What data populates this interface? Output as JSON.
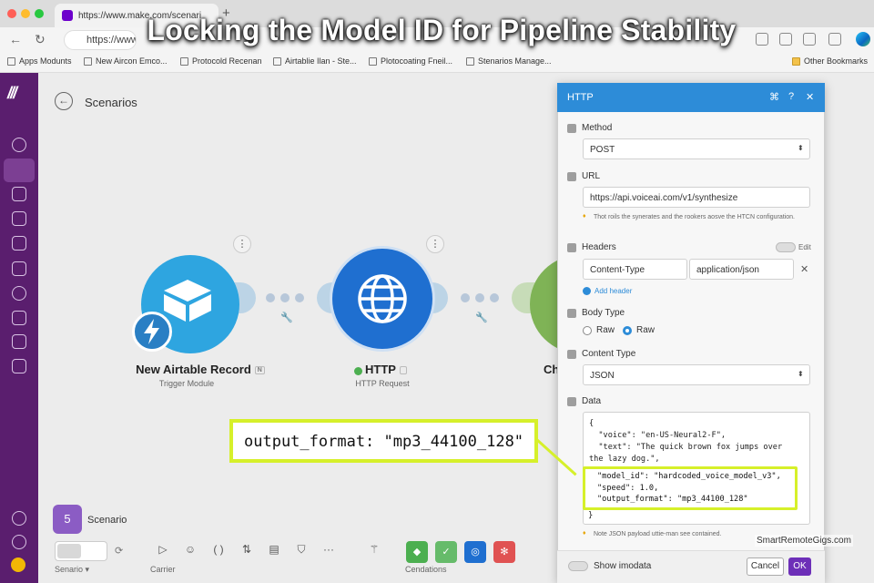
{
  "headline": "Locking the Model ID for Pipeline Stability",
  "browser": {
    "tab_title": "https://www.make.com/scenari",
    "url": "https://www.",
    "bookmarks": [
      "Apps Modunts",
      "New Aircon Emco...",
      "Protocold Recenan",
      "Airtablie Ilan - Ste...",
      "Plotocoating Fneil...",
      "Stenarios Manage..."
    ],
    "other_bookmarks": "Other Bookmarks"
  },
  "page": {
    "title": "Scenarios"
  },
  "nodes": {
    "airtable": {
      "title": "New Airtable Record",
      "subtitle": "Trigger Module",
      "tag": "N"
    },
    "http": {
      "title": "HTTP",
      "subtitle": "HTTP Request"
    },
    "third": {
      "title": "Ch"
    }
  },
  "bottom": {
    "scenario_label": "Scenario",
    "scenario_dropdown": "Senario",
    "carrier": "Carrier",
    "cendations": "Cendations"
  },
  "panel": {
    "title": "HTTP",
    "method_label": "Method",
    "method_value": "POST",
    "url_label": "URL",
    "url_value": "https://api.voiceai.com/v1/synthesize",
    "url_hint": "Thot roils the synerates and the rookers aosve the HTCN configuration.",
    "headers_label": "Headers",
    "headers_toggle": "Edit",
    "header_key": "Content-Type",
    "header_value": "application/json",
    "add_header": "Add header",
    "body_type_label": "Body Type",
    "body_raw_1": "Raw",
    "body_raw_2": "Raw",
    "content_type_label": "Content Type",
    "content_type_value": "JSON",
    "data_label": "Data",
    "data_lines": {
      "l1": "{",
      "l2": "  \"voice\": \"en-US-Neural2-F\",",
      "l3": "  \"text\": \"The quick brown fox jumps over",
      "l4": "the lazy dog.\","
    },
    "highlight_lines": {
      "l1": "\"model_id\": \"hardcoded_voice_model_v3\",",
      "l2": "\"speed\": 1.0,",
      "l3": "\"output_format\": \"mp3_44100_128\""
    },
    "data_close": "}",
    "note": "Note JSON payload uttie-man see contained.",
    "show_advanced": "Show imodata",
    "cancel": "Cancel",
    "ok": "OK"
  },
  "callout": "output_format: \"mp3_44100_128\"",
  "watermark": "SmartRemoteGigs.com",
  "colors": {
    "accent": "#2d8cd8",
    "highlight": "#d6f02a",
    "sidebar": "#5a1e6e",
    "ok": "#6d2fb8"
  }
}
